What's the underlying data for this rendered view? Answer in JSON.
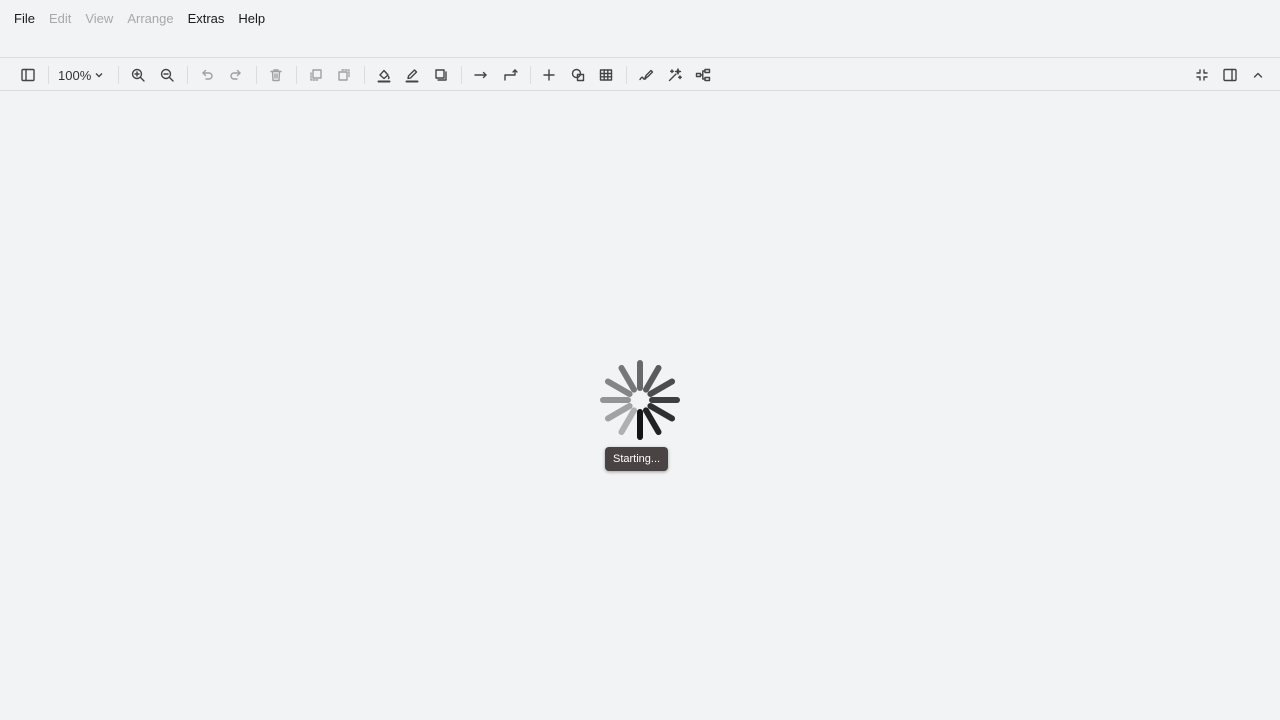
{
  "menu": [
    {
      "label": "File",
      "enabled": true
    },
    {
      "label": "Edit",
      "enabled": false
    },
    {
      "label": "View",
      "enabled": false
    },
    {
      "label": "Arrange",
      "enabled": false
    },
    {
      "label": "Extras",
      "enabled": true
    },
    {
      "label": "Help",
      "enabled": true
    }
  ],
  "toolbar": {
    "zoom_label": "100%",
    "icons": [
      "sidebar-toggle-icon",
      "zoom-in-icon",
      "zoom-out-icon",
      "undo-icon",
      "redo-icon",
      "delete-icon",
      "to-front-icon",
      "to-back-icon",
      "fill-color-icon",
      "line-color-icon",
      "shadow-icon",
      "connection-icon",
      "waypoints-icon",
      "insert-plus-icon",
      "shapes-icon",
      "table-icon",
      "freehand-icon",
      "magic-wand-icon",
      "layout-icon",
      "fullscreen-icon",
      "format-panel-icon",
      "collapse-icon"
    ]
  },
  "loading": {
    "status": "Starting..."
  },
  "colors": {
    "background": "#f1f3f4",
    "tooltip_bg": "#4a4343",
    "tooltip_text": "#ffffff"
  }
}
